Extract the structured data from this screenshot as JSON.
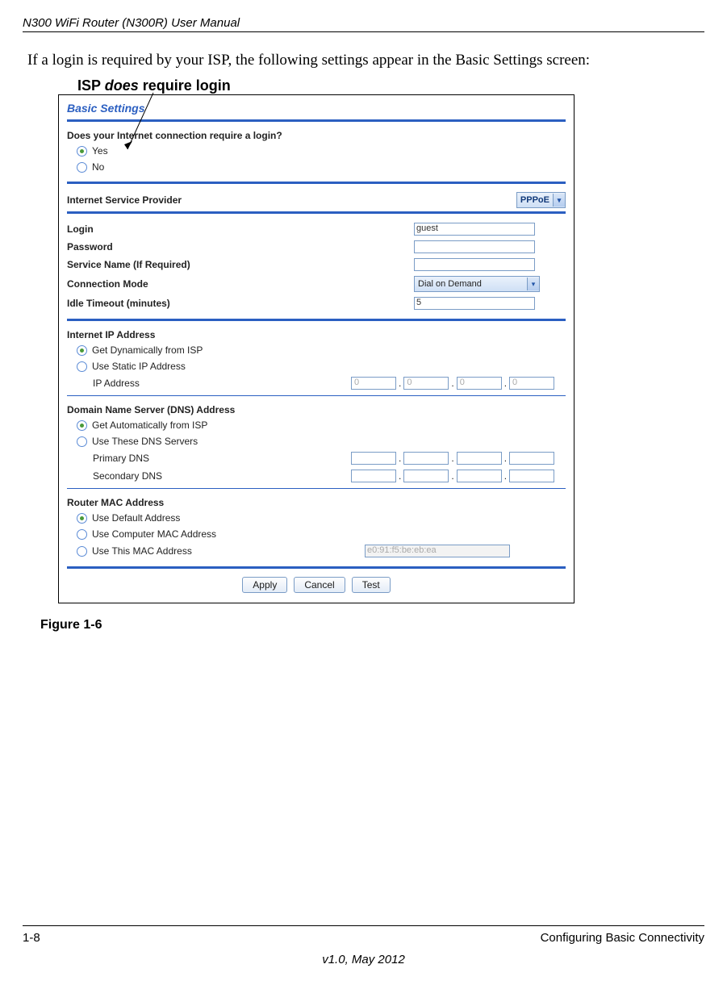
{
  "manual_title": "N300 WiFi Router (N300R) User Manual",
  "intro_text": "If a login is required by your ISP, the following settings appear in the Basic Settings screen:",
  "callout_prefix": "ISP ",
  "callout_em": "does",
  "callout_suffix": " require login",
  "panel": {
    "title": "Basic Settings",
    "q_login": "Does your Internet connection require a login?",
    "yes": "Yes",
    "no": "No",
    "isp_label": "Internet Service Provider",
    "isp_value": "PPPoE",
    "login_label": "Login",
    "login_value": "guest",
    "password_label": "Password",
    "password_value": "",
    "service_label": "Service Name (If Required)",
    "service_value": "",
    "connmode_label": "Connection Mode",
    "connmode_value": "Dial on Demand",
    "idle_label": "Idle Timeout (minutes)",
    "idle_value": "5",
    "ip_head": "Internet IP Address",
    "ip_dyn": "Get Dynamically from ISP",
    "ip_static": "Use Static IP Address",
    "ip_addr_label": "IP Address",
    "ip_octets": [
      "0",
      "0",
      "0",
      "0"
    ],
    "dns_head": "Domain Name Server (DNS) Address",
    "dns_auto": "Get Automatically from ISP",
    "dns_use": "Use These DNS Servers",
    "dns_primary": "Primary DNS",
    "dns_secondary": "Secondary DNS",
    "mac_head": "Router MAC Address",
    "mac_default": "Use Default Address",
    "mac_computer": "Use Computer MAC Address",
    "mac_this": "Use This MAC Address",
    "mac_value": "e0:91:f5:be:eb:ea",
    "btn_apply": "Apply",
    "btn_cancel": "Cancel",
    "btn_test": "Test"
  },
  "figure_caption": "Figure 1-6",
  "footer_left": "1-8",
  "footer_right": "Configuring Basic Connectivity",
  "footer_center": "v1.0, May 2012"
}
